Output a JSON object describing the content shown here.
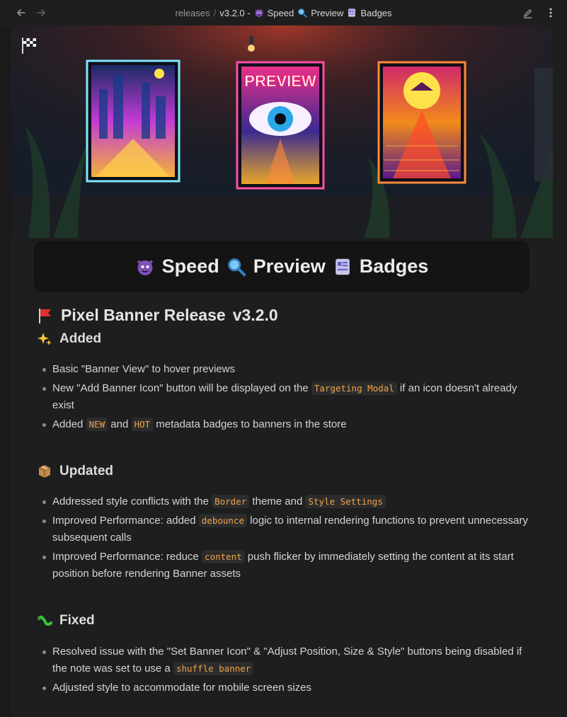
{
  "topbar": {
    "back_icon": "arrow-left-icon",
    "forward_icon": "arrow-right-icon",
    "breadcrumb_parent": "releases",
    "breadcrumb_separator": "/",
    "breadcrumb_current": "v3.2.0 -",
    "breadcrumb_speed": "Speed",
    "breadcrumb_preview": "Preview",
    "breadcrumb_badges": "Badges",
    "edit_icon": "pencil-icon",
    "more_icon": "vertical-dots-icon"
  },
  "banner": {
    "poster_center_text": "PREVIEW",
    "flag_icon": "checkered-flag-icon"
  },
  "badge_box": {
    "item1": "Speed",
    "item2": "Preview",
    "item3": "Badges"
  },
  "title": {
    "name": "Pixel Banner Release",
    "version": "v3.2.0"
  },
  "sections": {
    "added": {
      "heading": "Added",
      "items": [
        {
          "pre": "Basic \"Banner View\" to hover previews"
        },
        {
          "pre": "New \"Add Banner Icon\" button will be displayed on the ",
          "code": "Targeting Modal",
          "post": " if an icon doesn't already exist"
        },
        {
          "pre": "Added ",
          "code": "NEW",
          "mid": " and ",
          "code2": "HOT",
          "post": " metadata badges to banners in the store"
        }
      ]
    },
    "updated": {
      "heading": "Updated",
      "items": [
        {
          "pre": "Addressed style conflicts with the ",
          "code": "Border",
          "mid": " theme and ",
          "code2": "Style Settings"
        },
        {
          "pre": "Improved Performance: added ",
          "code": "debounce",
          "post": " logic to internal rendering functions to prevent unnecessary subsequent calls"
        },
        {
          "pre": "Improved Performance: reduce ",
          "code": "content",
          "post": " push flicker by immediately setting the content at its start position before rendering Banner assets"
        }
      ]
    },
    "fixed": {
      "heading": "Fixed",
      "items": [
        {
          "pre": "Resolved issue with the \"Set Banner Icon\" & \"Adjust Position, Size & Style\" buttons being disabled if the note was set to use a ",
          "code": "shuffle banner"
        },
        {
          "pre": "Adjusted style to accommodate for mobile screen sizes"
        }
      ]
    }
  },
  "colors": {
    "background": "#1e1e1e",
    "code_text": "#f0a34a",
    "code_bg": "#2c2c2c",
    "badge_box_bg": "#141414"
  }
}
